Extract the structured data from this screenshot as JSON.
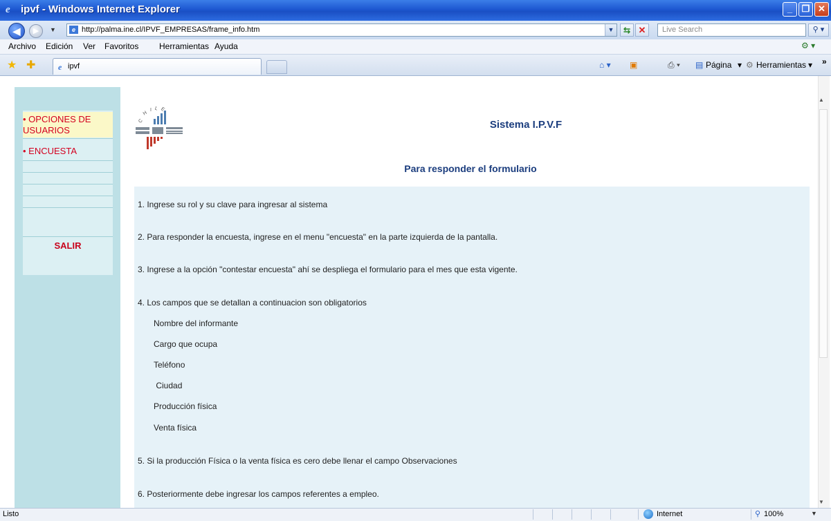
{
  "window": {
    "title": "ipvf - Windows Internet Explorer",
    "min_glyph": "_",
    "max_glyph": "❐",
    "close_glyph": "✕"
  },
  "address_bar": {
    "url": "http://palma.ine.cl/IPVF_EMPRESAS/frame_info.htm",
    "search_placeholder": "Live Search"
  },
  "menu": [
    "Archivo",
    "Edición",
    "Ver",
    "Favoritos",
    "Herramientas",
    "Ayuda"
  ],
  "tab": {
    "label": "ipvf"
  },
  "command_bar": {
    "page_label": "Página",
    "tools_label": "Herramientas",
    "more": "»"
  },
  "sidebar": {
    "items": [
      "• OPCIONES DE USUARIOS",
      "• ENCUESTA"
    ],
    "exit_label": "SALIR"
  },
  "header": {
    "system_title": "Sistema I.P.V.F",
    "form_title": "Para responder el formulario",
    "logo_text": "INE",
    "logo_arc": "CHILE"
  },
  "instructions": {
    "step1": "1. Ingrese su rol y su clave para ingresar al sistema",
    "step2": "2. Para responder la encuesta, ingrese en el menu \"encuesta\" en la parte izquierda de la pantalla.",
    "step3": "3. Ingrese a la opción \"contestar encuesta\" ahí se despliega el formulario para el mes que esta vigente.",
    "step4": "4. Los campos que se detallan a continuacion son obligatorios",
    "fields": [
      "Nombre del informante",
      "Cargo que ocupa",
      "Teléfono",
      " Ciudad",
      "Producción física",
      "Venta física"
    ],
    "step5": "5. Si la producción Física o la venta física es cero debe llenar el campo Observaciones",
    "step6": "6. Posteriormente debe ingresar los campos referentes a empleo."
  },
  "status_bar": {
    "status": "Listo",
    "zone": "Internet",
    "zoom": "100%"
  }
}
